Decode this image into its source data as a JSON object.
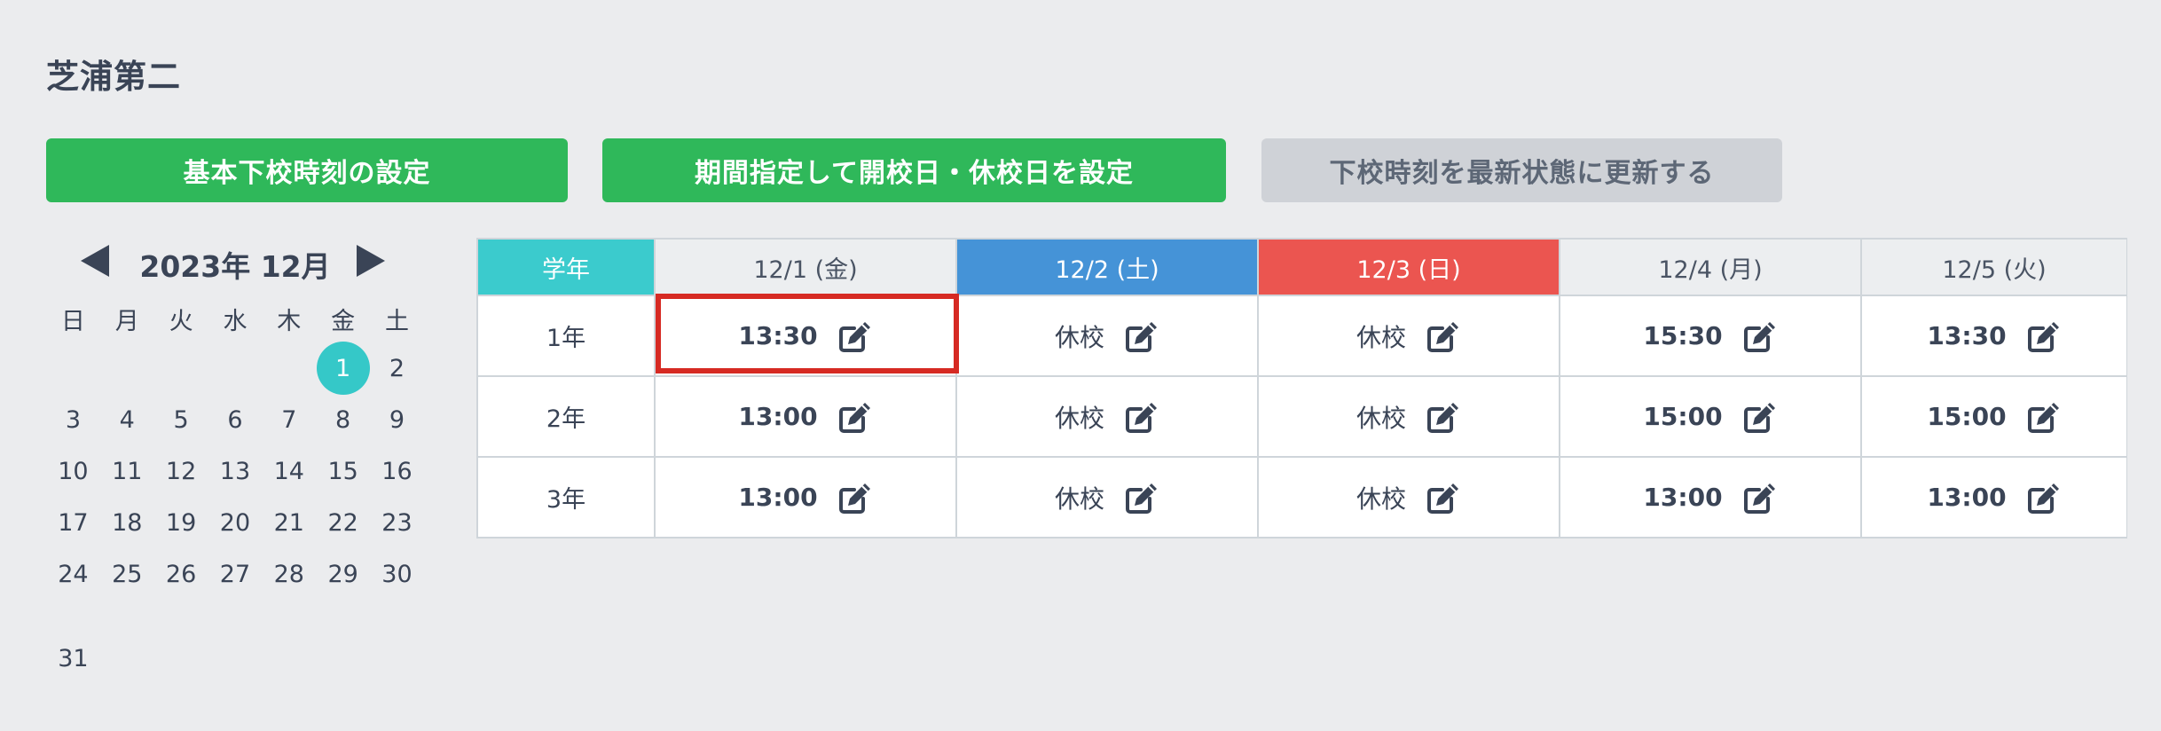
{
  "school_name": "芝浦第二",
  "buttons": {
    "basic_time": "基本下校時刻の設定",
    "period_setting": "期間指定して開校日・休校日を設定",
    "update_latest": "下校時刻を最新状態に更新する"
  },
  "calendar": {
    "title": "2023年 12月",
    "weekdays": [
      "日",
      "月",
      "火",
      "水",
      "木",
      "金",
      "土"
    ],
    "weeks": [
      [
        "",
        "",
        "",
        "",
        "",
        "1",
        "2"
      ],
      [
        "3",
        "4",
        "5",
        "6",
        "7",
        "8",
        "9"
      ],
      [
        "10",
        "11",
        "12",
        "13",
        "14",
        "15",
        "16"
      ],
      [
        "17",
        "18",
        "19",
        "20",
        "21",
        "22",
        "23"
      ],
      [
        "24",
        "25",
        "26",
        "27",
        "28",
        "29",
        "30"
      ],
      [
        "31",
        "",
        "",
        "",
        "",
        "",
        ""
      ]
    ],
    "selected_day": "1",
    "selected_color": "#35c8c8"
  },
  "schedule": {
    "grade_header": "学年",
    "days": [
      {
        "label": "12/1 (金)",
        "kind": "weekday"
      },
      {
        "label": "12/2 (土)",
        "kind": "saturday"
      },
      {
        "label": "12/3 (日)",
        "kind": "sunday"
      },
      {
        "label": "12/4 (月)",
        "kind": "weekday"
      },
      {
        "label": "12/5 (火)",
        "kind": "weekday"
      }
    ],
    "rows": [
      {
        "grade": "1年",
        "cells": [
          "13:30",
          "休校",
          "休校",
          "15:30",
          "13:30"
        ]
      },
      {
        "grade": "2年",
        "cells": [
          "13:00",
          "休校",
          "休校",
          "15:00",
          "15:00"
        ]
      },
      {
        "grade": "3年",
        "cells": [
          "13:00",
          "休校",
          "休校",
          "13:00",
          "13:00"
        ]
      }
    ],
    "closed_label": "休校",
    "highlight_color": "#d62a23",
    "saturday_color": "#4593d7",
    "sunday_color": "#eb5550"
  }
}
